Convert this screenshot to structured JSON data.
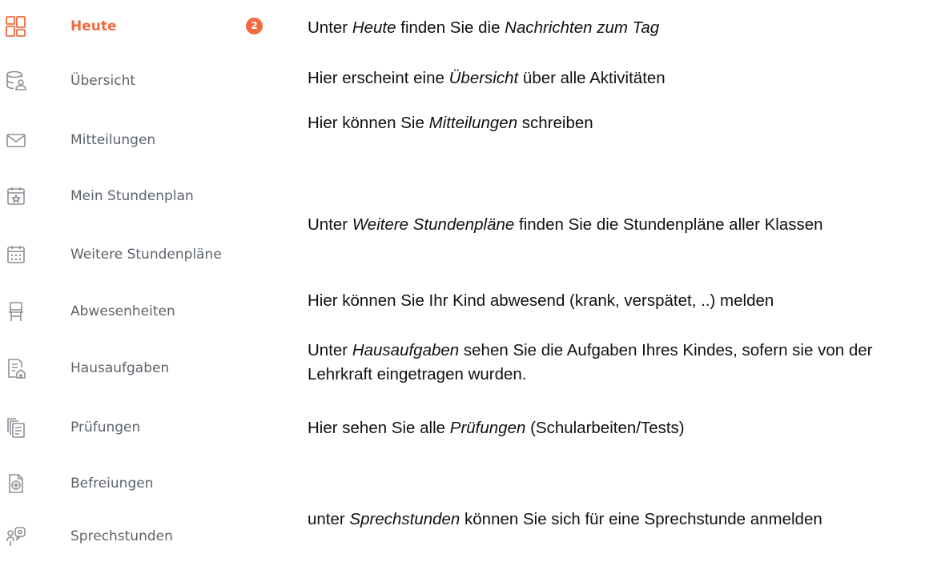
{
  "colors": {
    "accent": "#f26a3d",
    "inactive": "#5c636b",
    "text": "#111111"
  },
  "nav": {
    "items": [
      {
        "label": "Heute",
        "icon": "dashboard-grid-icon",
        "badge": "2",
        "active": true
      },
      {
        "label": "Übersicht",
        "icon": "database-user-icon"
      },
      {
        "label": "Mitteilungen",
        "icon": "envelope-icon"
      },
      {
        "label": "Mein Stundenplan",
        "icon": "calendar-star-icon"
      },
      {
        "label": "Weitere Stundenpläne",
        "icon": "calendar-grid-icon"
      },
      {
        "label": "Abwesenheiten",
        "icon": "chair-icon"
      },
      {
        "label": "Hausaufgaben",
        "icon": "document-house-icon"
      },
      {
        "label": "Prüfungen",
        "icon": "stacked-documents-icon"
      },
      {
        "label": "Befreiungen",
        "icon": "document-plus-icon"
      },
      {
        "label": "Sprechstunden",
        "icon": "speech-bubble-people-icon"
      }
    ]
  },
  "descriptions": {
    "heute": {
      "t1": "Unter ",
      "i1": "Heute",
      "t2": " finden Sie die ",
      "i2": "Nachrichten zum Tag"
    },
    "uebersicht": {
      "t1": "Hier erscheint eine ",
      "i1": "Übersicht",
      "t2": " über alle Aktivitäten"
    },
    "mitteilungen": {
      "t1": "Hier können Sie ",
      "i1": "Mitteilungen",
      "t2": " schreiben"
    },
    "weitere": {
      "t1": "Unter ",
      "i1": "Weitere Stundenpläne",
      "t2": " finden Sie die Stundenpläne aller Klassen"
    },
    "abwesenheiten": {
      "text": "Hier können Sie Ihr Kind abwesend (krank, verspätet, ..) melden"
    },
    "hausaufgaben": {
      "t1": "Unter ",
      "i1": "Hausaufgaben",
      "t2": " sehen Sie die Aufgaben Ihres Kindes, sofern sie von der Lehrkraft eingetragen wurden."
    },
    "pruefungen": {
      "t1": "Hier sehen Sie alle ",
      "i1": "Prüfungen",
      "t2": " (Schularbeiten/Tests)"
    },
    "sprechstunden": {
      "t1": "unter ",
      "i1": "Sprechstunden",
      "t2": " können Sie sich für eine Sprechstunde anmelden"
    }
  }
}
